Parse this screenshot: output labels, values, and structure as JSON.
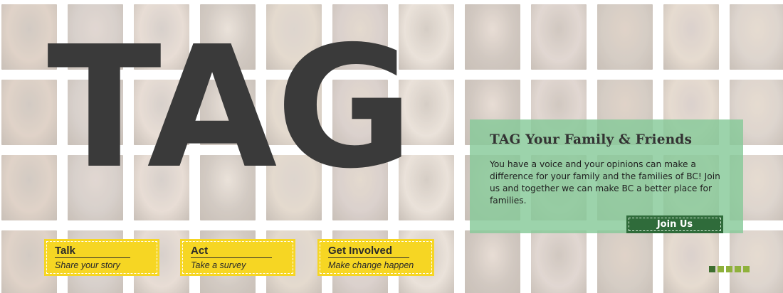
{
  "hero": {
    "title": "TAG"
  },
  "info_panel": {
    "heading": "TAG Your Family & Friends",
    "body": "You have a voice and your opinions can make a difference for your family and the families of BC! Join us and together we can make BC a better place for families.",
    "button_label": "Join Us"
  },
  "actions": [
    {
      "title": "Talk",
      "subtitle": "Share your story"
    },
    {
      "title": "Act",
      "subtitle": "Take a survey"
    },
    {
      "title": "Get Involved",
      "subtitle": "Make change happen"
    }
  ],
  "pager": {
    "count": 5,
    "active_index": 0
  },
  "colors": {
    "panel_green": "#86c998",
    "button_green": "#2f6b3a",
    "card_yellow": "#f6d623",
    "pager_green": "#8fb13c",
    "title_gray": "#3a3a3a"
  }
}
